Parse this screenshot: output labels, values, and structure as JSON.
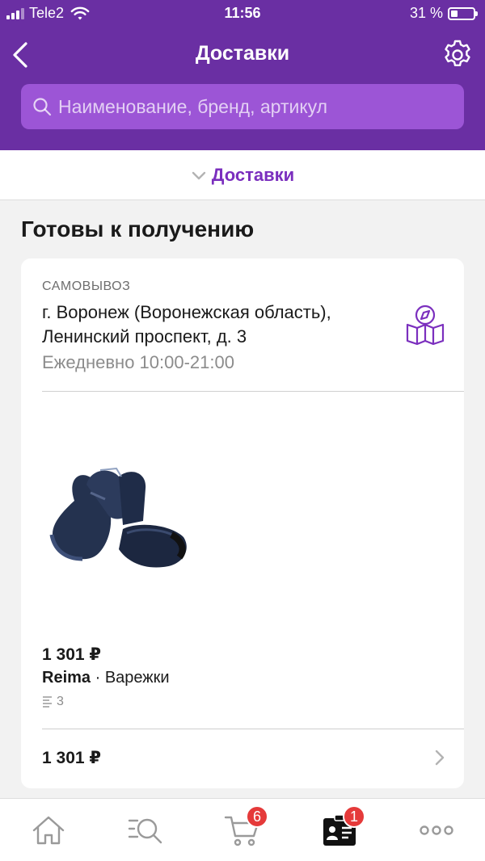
{
  "status_bar": {
    "carrier": "Tele2",
    "time": "11:56",
    "battery": "31 %",
    "battery_level": 0.31
  },
  "nav": {
    "title": "Доставки",
    "back_icon": "chevron-left-icon",
    "settings_icon": "gear-icon"
  },
  "search": {
    "placeholder": "Наименование, бренд, артикул"
  },
  "filter": {
    "label": "Доставки"
  },
  "section": {
    "title": "Готовы к получению"
  },
  "delivery": {
    "type": "САМОВЫВОЗ",
    "address_line1": "г. Воронеж (Воронежская область),",
    "address_line2": "Ленинский проспект, д. 3",
    "hours": "Ежедневно 10:00-21:00",
    "item": {
      "price": "1 301 ₽",
      "brand": "Reima",
      "separator": " · ",
      "name": "Варежки",
      "quantity": "3"
    },
    "total": "1 301 ₽"
  },
  "tabbar": {
    "tabs": [
      {
        "icon": "home-icon"
      },
      {
        "icon": "catalog-search-icon"
      },
      {
        "icon": "cart-icon",
        "badge": "6"
      },
      {
        "icon": "profile-card-icon",
        "badge": "1",
        "active": true
      },
      {
        "icon": "more-icon"
      }
    ]
  },
  "colors": {
    "header": "#6a2fa3",
    "search_bg": "#9c55d6",
    "accent": "#7b2fbe",
    "badge": "#e53a3a"
  }
}
